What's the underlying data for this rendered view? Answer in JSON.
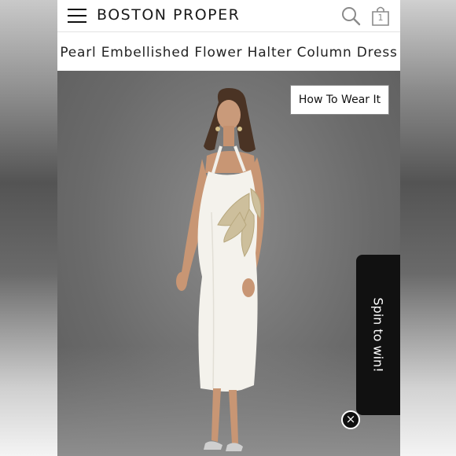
{
  "header": {
    "brand": "BOSTON PROPER",
    "bag_count": "1",
    "menu_icon": "hamburger-menu-icon",
    "search_icon": "search-icon",
    "bag_icon": "shopping-bag-icon"
  },
  "product": {
    "title": "Pearl Embellished Flower Halter Column Dress"
  },
  "photo": {
    "how_to_wear_label": "How To Wear It"
  },
  "promo": {
    "spin_label": "Spin to win!",
    "close_icon": "close-icon"
  },
  "colors": {
    "accent": "#111111",
    "dress": "#f5f3ee",
    "embellishment": "#cbbd97",
    "backdrop": "#6b6b6b"
  }
}
